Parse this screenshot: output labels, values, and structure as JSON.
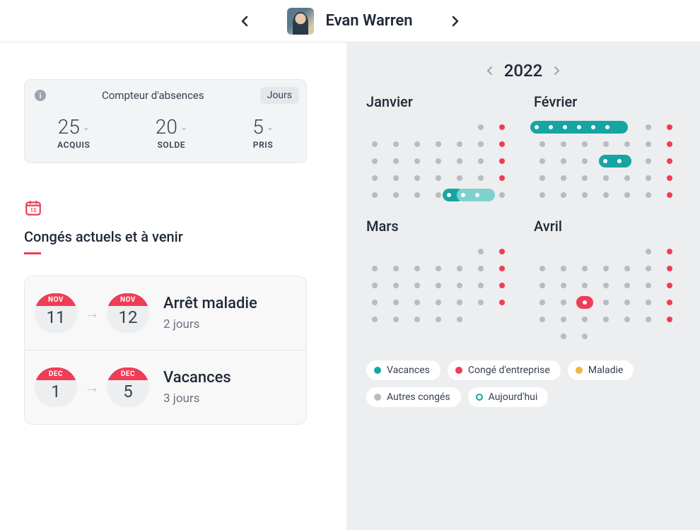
{
  "header": {
    "username": "Evan Warren"
  },
  "counter": {
    "title": "Compteur d'absences",
    "unit": "Jours",
    "acquired_value": "25",
    "acquired_label": "ACQUIS",
    "balance_value": "20",
    "balance_label": "SOLDE",
    "taken_value": "5",
    "taken_label": "PRIS"
  },
  "section": {
    "title": "Congés actuels et à venir"
  },
  "leaves": [
    {
      "from_month": "NOV",
      "from_day": "11",
      "to_month": "NOV",
      "to_day": "12",
      "title": "Arrêt maladie",
      "subtitle": "2 jours"
    },
    {
      "from_month": "DEC",
      "from_day": "1",
      "to_month": "DEC",
      "to_day": "5",
      "title": "Vacances",
      "subtitle": "3 jours"
    }
  ],
  "calendar": {
    "year": "2022",
    "months": [
      "Janvier",
      "Février",
      "Mars",
      "Avril"
    ]
  },
  "legend": {
    "vacances": "Vacances",
    "conge_entreprise": "Congé d'entreprise",
    "maladie": "Maladie",
    "autres": "Autres congés",
    "aujourdhui": "Aujourd'hui"
  }
}
